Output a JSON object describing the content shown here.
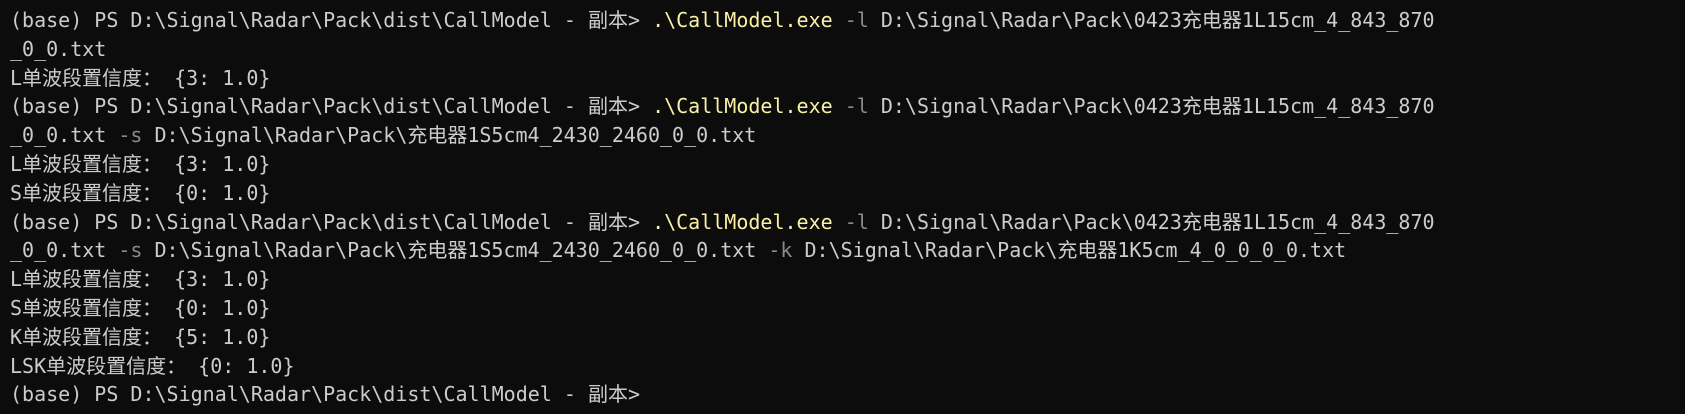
{
  "terminal": {
    "colors": {
      "background": "#0c0c0c",
      "text": "#cccccc",
      "executable": "#f9f1a5",
      "flag": "#8a8a8a"
    },
    "lines": [
      {
        "segments": [
          {
            "text": "(base) PS D:\\Signal\\Radar\\Pack\\dist\\CallModel - 副本> ",
            "role": "prompt"
          },
          {
            "text": ".\\CallModel.exe",
            "role": "exe"
          },
          {
            "text": " -l",
            "role": "flag"
          },
          {
            "text": " D:\\Signal\\Radar\\Pack\\0423充电器1L15cm_4_843_870",
            "role": "arg"
          }
        ]
      },
      {
        "segments": [
          {
            "text": "_0_0.txt",
            "role": "arg"
          }
        ]
      },
      {
        "segments": [
          {
            "text": "L单波段置信度： {3: 1.0}",
            "role": "out"
          }
        ]
      },
      {
        "segments": [
          {
            "text": "(base) PS D:\\Signal\\Radar\\Pack\\dist\\CallModel - 副本> ",
            "role": "prompt"
          },
          {
            "text": ".\\CallModel.exe",
            "role": "exe"
          },
          {
            "text": " -l",
            "role": "flag"
          },
          {
            "text": " D:\\Signal\\Radar\\Pack\\0423充电器1L15cm_4_843_870",
            "role": "arg"
          }
        ]
      },
      {
        "segments": [
          {
            "text": "_0_0.txt",
            "role": "arg"
          },
          {
            "text": " -s",
            "role": "flag"
          },
          {
            "text": " D:\\Signal\\Radar\\Pack\\充电器1S5cm4_2430_2460_0_0.txt",
            "role": "arg"
          }
        ]
      },
      {
        "segments": [
          {
            "text": "L单波段置信度： {3: 1.0}",
            "role": "out"
          }
        ]
      },
      {
        "segments": [
          {
            "text": "S单波段置信度： {0: 1.0}",
            "role": "out"
          }
        ]
      },
      {
        "segments": [
          {
            "text": "(base) PS D:\\Signal\\Radar\\Pack\\dist\\CallModel - 副本> ",
            "role": "prompt"
          },
          {
            "text": ".\\CallModel.exe",
            "role": "exe"
          },
          {
            "text": " -l",
            "role": "flag"
          },
          {
            "text": " D:\\Signal\\Radar\\Pack\\0423充电器1L15cm_4_843_870",
            "role": "arg"
          }
        ]
      },
      {
        "segments": [
          {
            "text": "_0_0.txt",
            "role": "arg"
          },
          {
            "text": " -s",
            "role": "flag"
          },
          {
            "text": " D:\\Signal\\Radar\\Pack\\充电器1S5cm4_2430_2460_0_0.txt",
            "role": "arg"
          },
          {
            "text": " -k",
            "role": "flag"
          },
          {
            "text": " D:\\Signal\\Radar\\Pack\\充电器1K5cm_4_0_0_0_0.txt",
            "role": "arg"
          }
        ]
      },
      {
        "segments": [
          {
            "text": "L单波段置信度： {3: 1.0}",
            "role": "out"
          }
        ]
      },
      {
        "segments": [
          {
            "text": "S单波段置信度： {0: 1.0}",
            "role": "out"
          }
        ]
      },
      {
        "segments": [
          {
            "text": "K单波段置信度： {5: 1.0}",
            "role": "out"
          }
        ]
      },
      {
        "segments": [
          {
            "text": "LSK单波段置信度： {0: 1.0}",
            "role": "out"
          }
        ]
      },
      {
        "segments": [
          {
            "text": "(base) PS D:\\Signal\\Radar\\Pack\\dist\\CallModel - 副本>",
            "role": "prompt"
          }
        ]
      }
    ]
  }
}
